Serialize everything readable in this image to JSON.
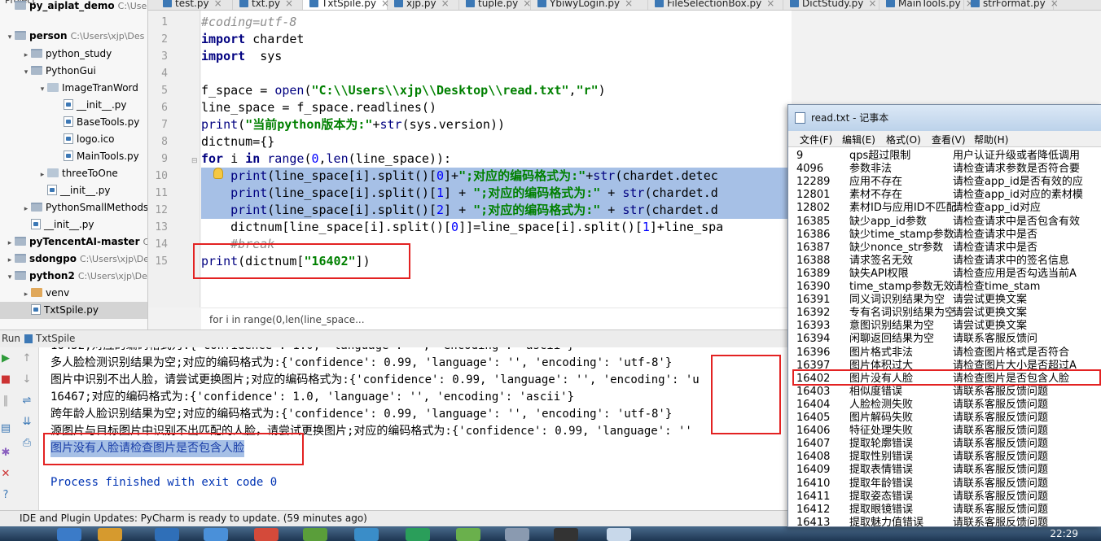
{
  "project": {
    "header": "Project",
    "items": [
      {
        "name": "py_aiplat_demo",
        "path": "C:\\Users",
        "bold": true
      },
      {
        "name": "person",
        "path": "C:\\Users\\xjp\\Des",
        "bold": true
      },
      {
        "name": "python_study",
        "path": ""
      },
      {
        "name": "PythonGui",
        "path": ""
      },
      {
        "name": "ImageTranWord",
        "path": ""
      },
      {
        "name": "__init__.py",
        "path": ""
      },
      {
        "name": "BaseTools.py",
        "path": ""
      },
      {
        "name": "logo.ico",
        "path": ""
      },
      {
        "name": "MainTools.py",
        "path": ""
      },
      {
        "name": "threeToOne",
        "path": ""
      },
      {
        "name": "__init__.py",
        "path": ""
      },
      {
        "name": "PythonSmallMethods",
        "path": ""
      },
      {
        "name": "__init__.py",
        "path": ""
      },
      {
        "name": "pyTencentAI-master",
        "path": "C:",
        "bold": true
      },
      {
        "name": "sdongpo",
        "path": "C:\\Users\\xjp\\De",
        "bold": true
      },
      {
        "name": "python2",
        "path": "C:\\Users\\xjp\\De",
        "bold": true
      },
      {
        "name": "venv",
        "path": ""
      },
      {
        "name": "TxtSpile.py",
        "path": ""
      }
    ]
  },
  "tabs": [
    "test.py",
    "txt.py",
    "TxtSpile.py",
    "xjp.py",
    "tuple.py",
    "YbiwyLogin.py",
    "FileSelectionBox.py",
    "DictStudy.py",
    "MainTools.py",
    "strFormat.py"
  ],
  "editor": {
    "line_numbers": [
      "1",
      "2",
      "3",
      "4",
      "5",
      "6",
      "7",
      "8",
      "9",
      "10",
      "11",
      "12",
      "13",
      "14",
      "15"
    ],
    "lines": [
      "#coding=utf-8",
      "import chardet",
      "import  sys",
      "",
      "f_space = open(\"C:\\\\Users\\\\xjp\\\\Desktop\\\\read.txt\",\"r\")",
      "line_space = f_space.readlines()",
      "print(\"当前python版本为:\"+str(sys.version))",
      "dictnum={}",
      "for i in range(0,len(line_space)):",
      "    print(line_space[i].split()[0]+\";对应的编码格式为:\"+str(chardet.detec",
      "    print(line_space[i].split()[1] + \";对应的编码格式为:\" + str(chardet.d",
      "    print(line_space[i].split()[2] + \";对应的编码格式为:\" + str(chardet.d",
      "    dictnum[line_space[i].split()[0]]=line_space[i].split()[1]+line_spa",
      "    #break",
      "print(dictnum[\"16402\"])"
    ],
    "breadcrumb": "for i in range(0,len(line_space..."
  },
  "run": {
    "title_prefix": "Run",
    "title": "TxtSpile",
    "output": [
      "16452;对应的编码格式为:{'confidence': 1.0, 'language': '', 'encoding': 'ascii'}",
      "多人脸检测识别结果为空;对应的编码格式为:{'confidence': 0.99, 'language': '', 'encoding': 'utf-8'}",
      "图片中识别不出人脸，请尝试更换图片;对应的编码格式为:{'confidence': 0.99, 'language': '', 'encoding': 'u",
      "16467;对应的编码格式为:{'confidence': 1.0, 'language': '', 'encoding': 'ascii'}",
      "跨年龄人脸识别结果为空;对应的编码格式为:{'confidence': 0.99, 'language': '', 'encoding': 'utf-8'}",
      "源图片与目标图片中识别不出匹配的人脸，请尝试更换图片;对应的编码格式为:{'confidence': 0.99, 'language': ''",
      "图片没有人脸请检查图片是否包含人脸",
      "",
      "Process finished with exit code 0"
    ]
  },
  "status": {
    "message": "IDE and Plugin Updates: PyCharm is ready to update. (59 minutes ago)"
  },
  "taskbar": {
    "clock": "22:29"
  },
  "notepad": {
    "title": "read.txt - 记事本",
    "menu": [
      "文件(F)",
      "编辑(E)",
      "格式(O)",
      "查看(V)",
      "帮助(H)"
    ],
    "rows": [
      [
        "9",
        "qps超过限制",
        "用户认证升级或者降低调用"
      ],
      [
        "4096",
        "参数非法",
        "请检查请求参数是否符合要"
      ],
      [
        "12289",
        "应用不存在",
        "请检查app_id是否有效的应"
      ],
      [
        "12801",
        "素材不存在",
        "请检查app_id对应的素材模"
      ],
      [
        "12802",
        "素材ID与应用ID不匹配",
        "请检查app_id对应"
      ],
      [
        "16385",
        "缺少app_id参数",
        "请检查请求中是否包含有效"
      ],
      [
        "16386",
        "缺少time_stamp参数",
        "请检查请求中是否"
      ],
      [
        "16387",
        "缺少nonce_str参数",
        "请检查请求中是否"
      ],
      [
        "16388",
        "请求签名无效",
        "请检查请求中的签名信息"
      ],
      [
        "16389",
        "缺失API权限",
        "请检查应用是否勾选当前A"
      ],
      [
        "16390",
        "time_stamp参数无效",
        "请检查time_stam"
      ],
      [
        "16391",
        "同义词识别结果为空",
        "请尝试更换文案"
      ],
      [
        "16392",
        "专有名词识别结果为空",
        "请尝试更换文案"
      ],
      [
        "16393",
        "意图识别结果为空",
        "请尝试更换文案"
      ],
      [
        "16394",
        "闲聊返回结果为空",
        "请联系客服反馈问"
      ],
      [
        "16396",
        "图片格式非法",
        "请检查图片格式是否符合"
      ],
      [
        "16397",
        "图片体积过大",
        "请检查图片大小是否超过A"
      ],
      [
        "16402",
        "图片没有人脸",
        "请检查图片是否包含人脸"
      ],
      [
        "16403",
        "相似度错误",
        "请联系客服反馈问题"
      ],
      [
        "16404",
        "人脸检测失败",
        "请联系客服反馈问题"
      ],
      [
        "16405",
        "图片解码失败",
        "请联系客服反馈问题"
      ],
      [
        "16406",
        "特征处理失败",
        "请联系客服反馈问题"
      ],
      [
        "16407",
        "提取轮廓错误",
        "请联系客服反馈问题"
      ],
      [
        "16408",
        "提取性别错误",
        "请联系客服反馈问题"
      ],
      [
        "16409",
        "提取表情错误",
        "请联系客服反馈问题"
      ],
      [
        "16410",
        "提取年龄错误",
        "请联系客服反馈问题"
      ],
      [
        "16411",
        "提取姿态错误",
        "请联系客服反馈问题"
      ],
      [
        "16412",
        "提取眼镜错误",
        "请联系客服反馈问题"
      ],
      [
        "16413",
        "提取魅力值错误",
        "请联系客服反馈问题"
      ]
    ]
  },
  "colors": {
    "annotation_red": "#e32222",
    "selection": "#a6c0e6"
  }
}
